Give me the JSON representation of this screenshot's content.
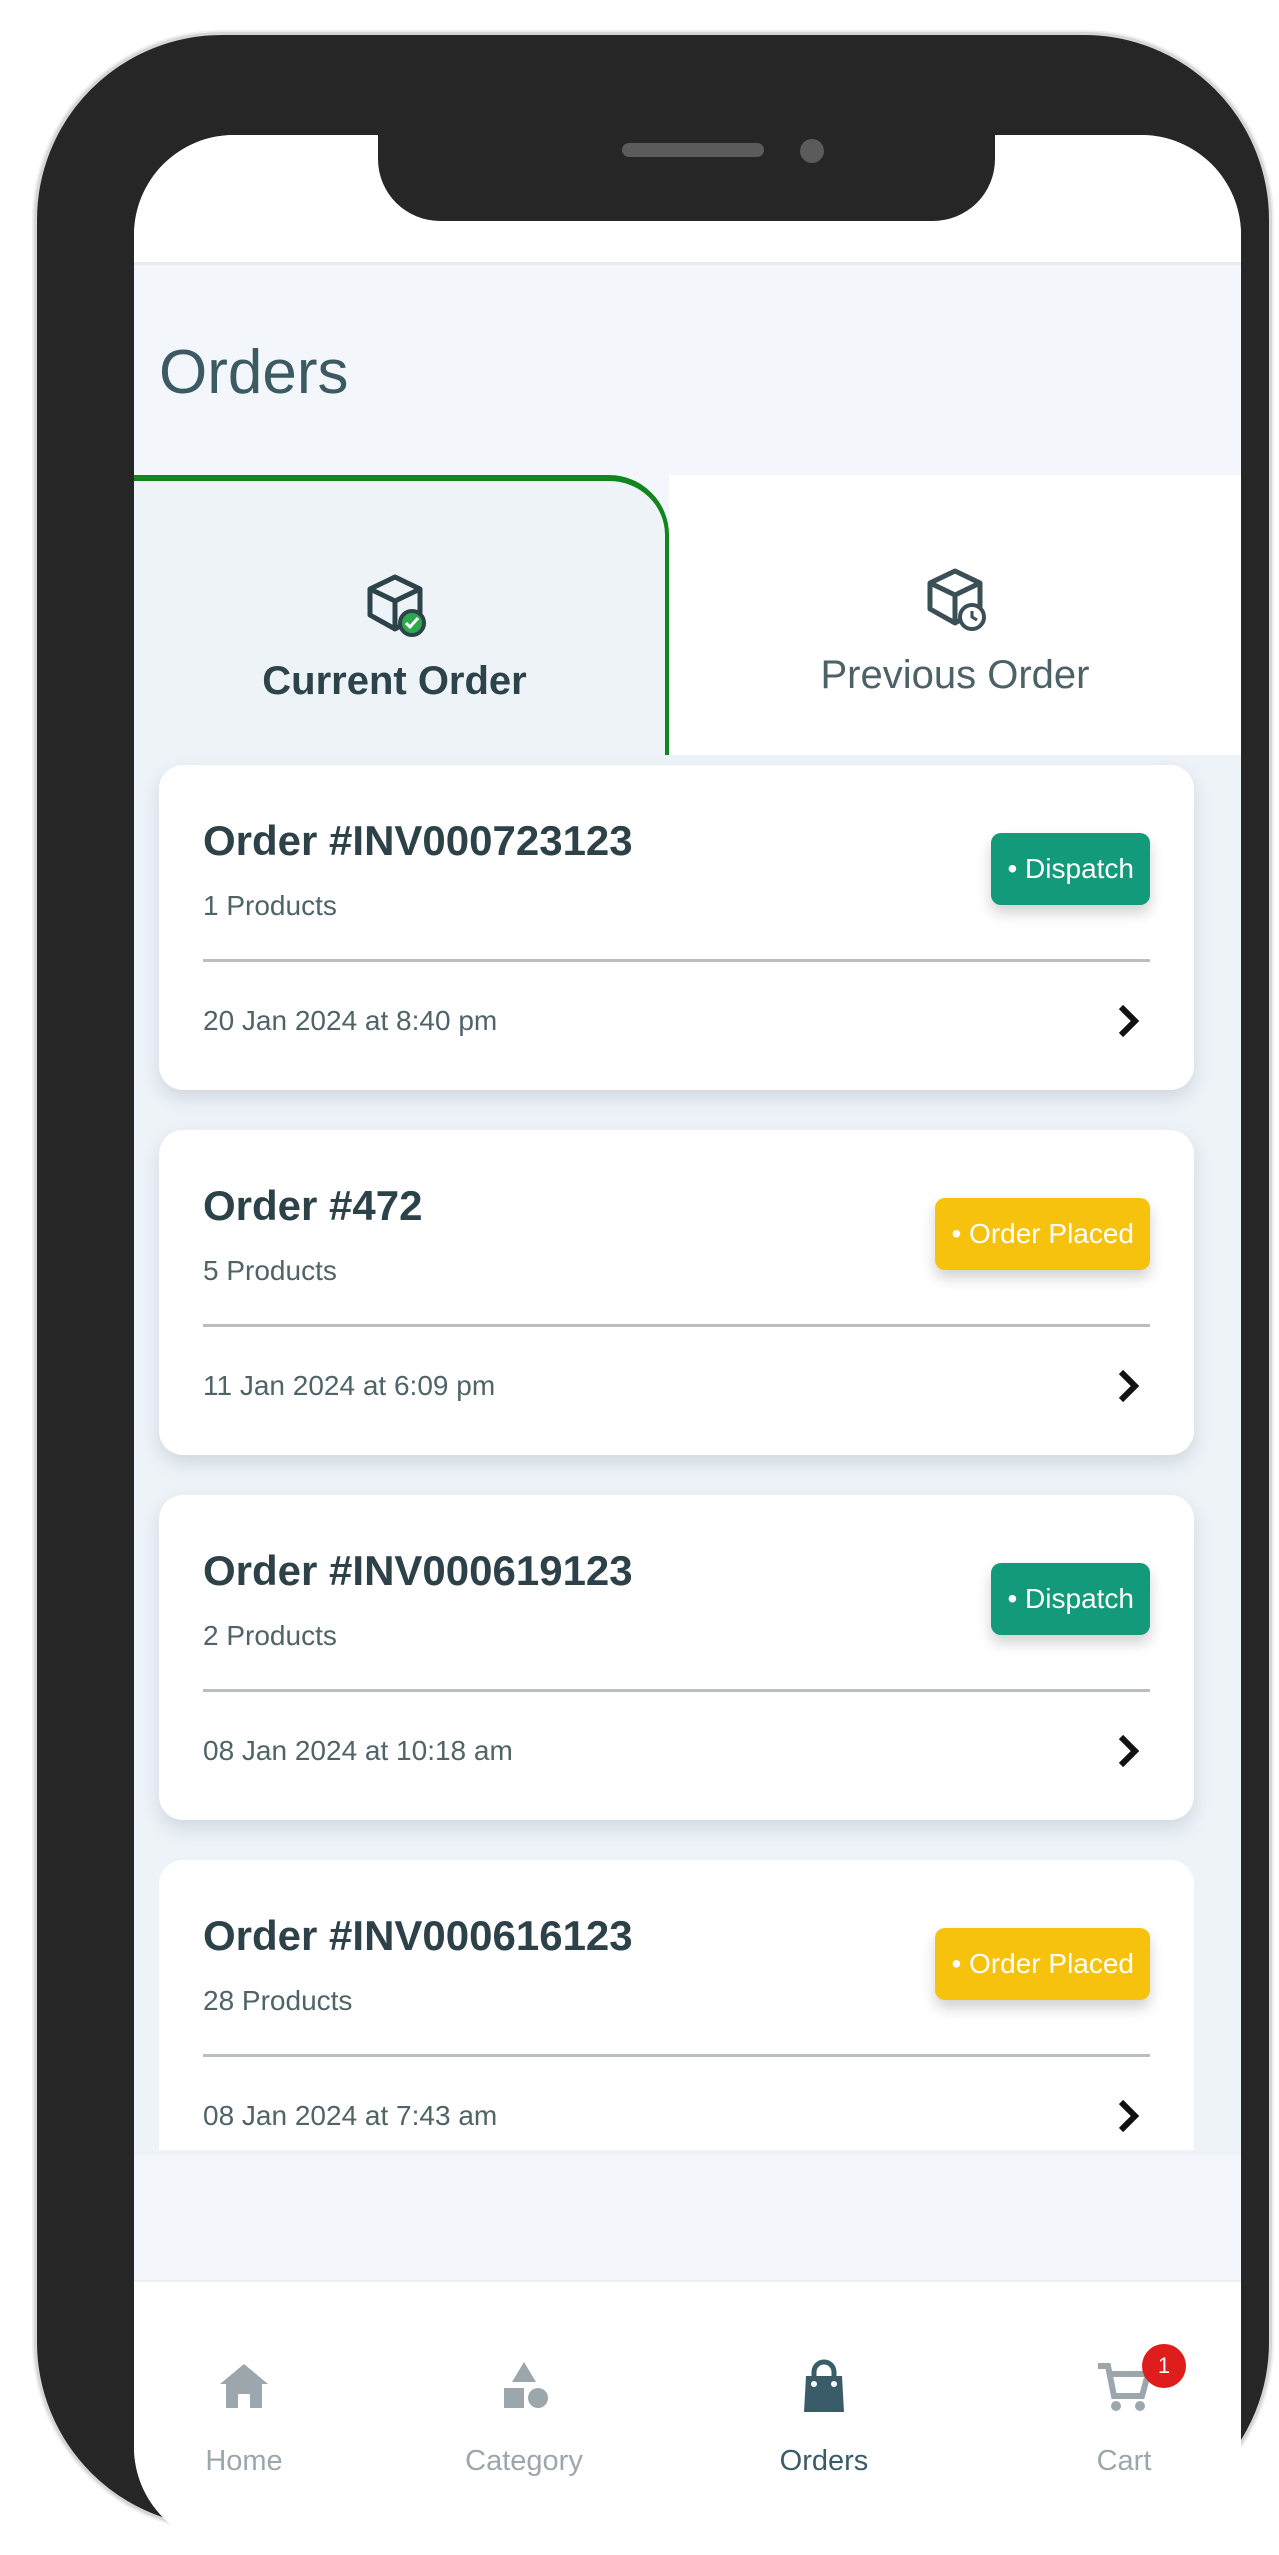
{
  "page": {
    "title": "Orders"
  },
  "tabs": [
    {
      "label": "Current Order",
      "icon": "box-check-icon",
      "active": true
    },
    {
      "label": "Previous Order",
      "icon": "box-clock-icon",
      "active": false
    }
  ],
  "orders": [
    {
      "title": "Order #INV000723123",
      "products": "1 Products",
      "status": "• Dispatch",
      "date": "20 Jan 2024 at 8:40 pm"
    },
    {
      "title": "Order #472",
      "products": "5 Products",
      "status": "• Order Placed",
      "date": "11 Jan 2024 at 6:09 pm"
    },
    {
      "title": "Order #INV000619123",
      "products": "2 Products",
      "status": "• Dispatch",
      "date": "08 Jan 2024 at 10:18 am"
    },
    {
      "title": "Order #INV000616123",
      "products": "28 Products",
      "status": "• Order Placed",
      "date": "08 Jan 2024 at 7:43 am"
    }
  ],
  "nav": [
    {
      "label": "Home",
      "icon": "home-icon"
    },
    {
      "label": "Category",
      "icon": "category-icon"
    },
    {
      "label": "Orders",
      "icon": "shopping-bag-icon",
      "active": true
    },
    {
      "label": "Cart",
      "icon": "cart-icon",
      "badge": "1"
    }
  ],
  "colors": {
    "accent_green": "#11861c",
    "dispatch": "#139a7a",
    "order_placed": "#f7c20e",
    "text_dark": "#2c4248",
    "cart_badge": "#e01d1d"
  }
}
